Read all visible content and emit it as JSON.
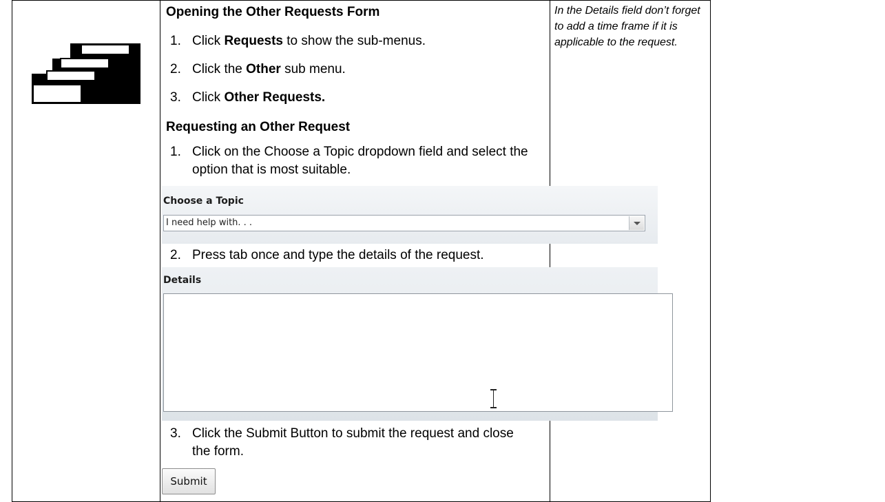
{
  "sections": [
    {
      "title": "Opening the Other Requests Form",
      "steps": [
        {
          "num": "1.",
          "pre": "Click ",
          "bold": "Requests",
          "post": " to show the sub-menus."
        },
        {
          "num": "2.",
          "pre": "Click the ",
          "bold": "Other",
          "post": " sub menu."
        },
        {
          "num": "3.",
          "pre": "Click ",
          "bold": "Other Requests.",
          "post": ""
        }
      ]
    },
    {
      "title": "Requesting an Other Request",
      "steps": [
        {
          "num": "1.",
          "line1": "Click on the Choose a Topic dropdown field and select the",
          "line2": "option that is most suitable."
        },
        {
          "num": "2.",
          "line1": "Press tab once and type the details of the request."
        },
        {
          "num": "3.",
          "line1": "Click the Submit Button to submit the request and close",
          "line2": "the form."
        }
      ]
    }
  ],
  "topic_panel": {
    "label": "Choose a Topic",
    "value": "I need help with. . ."
  },
  "details_panel": {
    "label": "Details",
    "value": ""
  },
  "submit_label": "Submit",
  "note": "In the Details field don’t forget to add a time frame if it is applicable to the request.",
  "icons": {
    "steps": "staircase-steps-icon",
    "dropdown": "chevron-down-icon",
    "cursor": "text-cursor-icon"
  }
}
